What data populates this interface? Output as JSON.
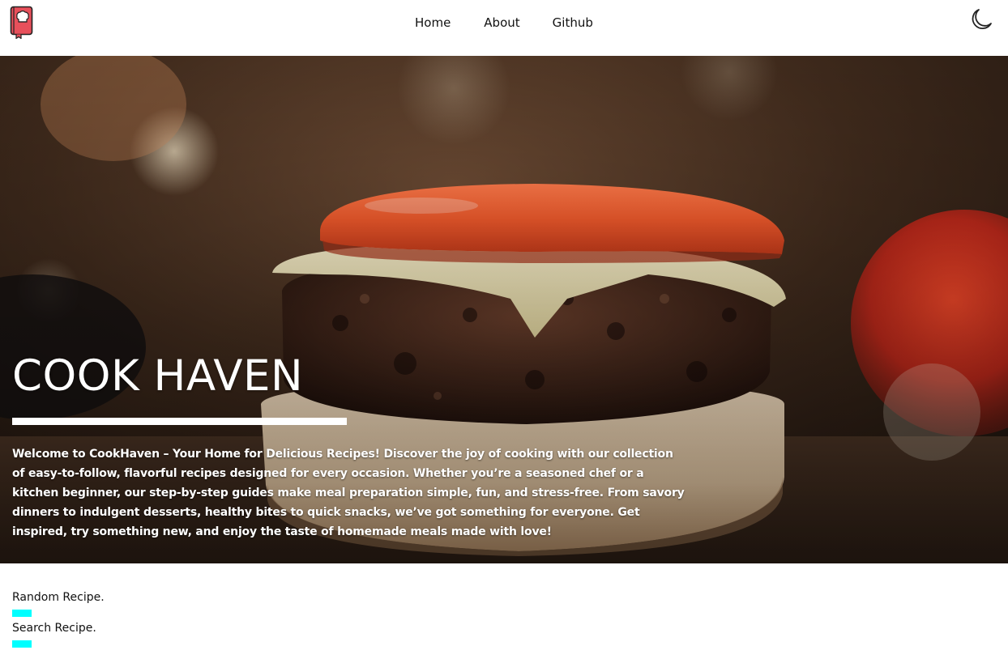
{
  "colors": {
    "accent": "#00ffff",
    "logo_red": "#e8505b",
    "text": "#111111",
    "hero_text": "#ffffff"
  },
  "navbar": {
    "logo_icon": "chef-recipe-book-icon",
    "links": [
      {
        "label": "Home"
      },
      {
        "label": "About"
      },
      {
        "label": "Github"
      }
    ],
    "theme_toggle_icon": "moon-icon"
  },
  "hero": {
    "image_icon": "burger-photo",
    "title": "COOK HAVEN",
    "description": "Welcome to CookHaven – Your Home for Delicious Recipes! Discover the joy of cooking with our collection of easy-to-follow, flavorful recipes designed for every occasion. Whether you’re a seasoned chef or a kitchen beginner, our step-by-step guides make meal preparation simple, fun, and stress-free. From savory dinners to indulgent desserts, healthy bites to quick snacks, we’ve got something for everyone. Get inspired, try something new, and enjoy the taste of homemade meals made with love!"
  },
  "sections": [
    {
      "label": "Random Recipe."
    },
    {
      "label": "Search Recipe."
    }
  ]
}
